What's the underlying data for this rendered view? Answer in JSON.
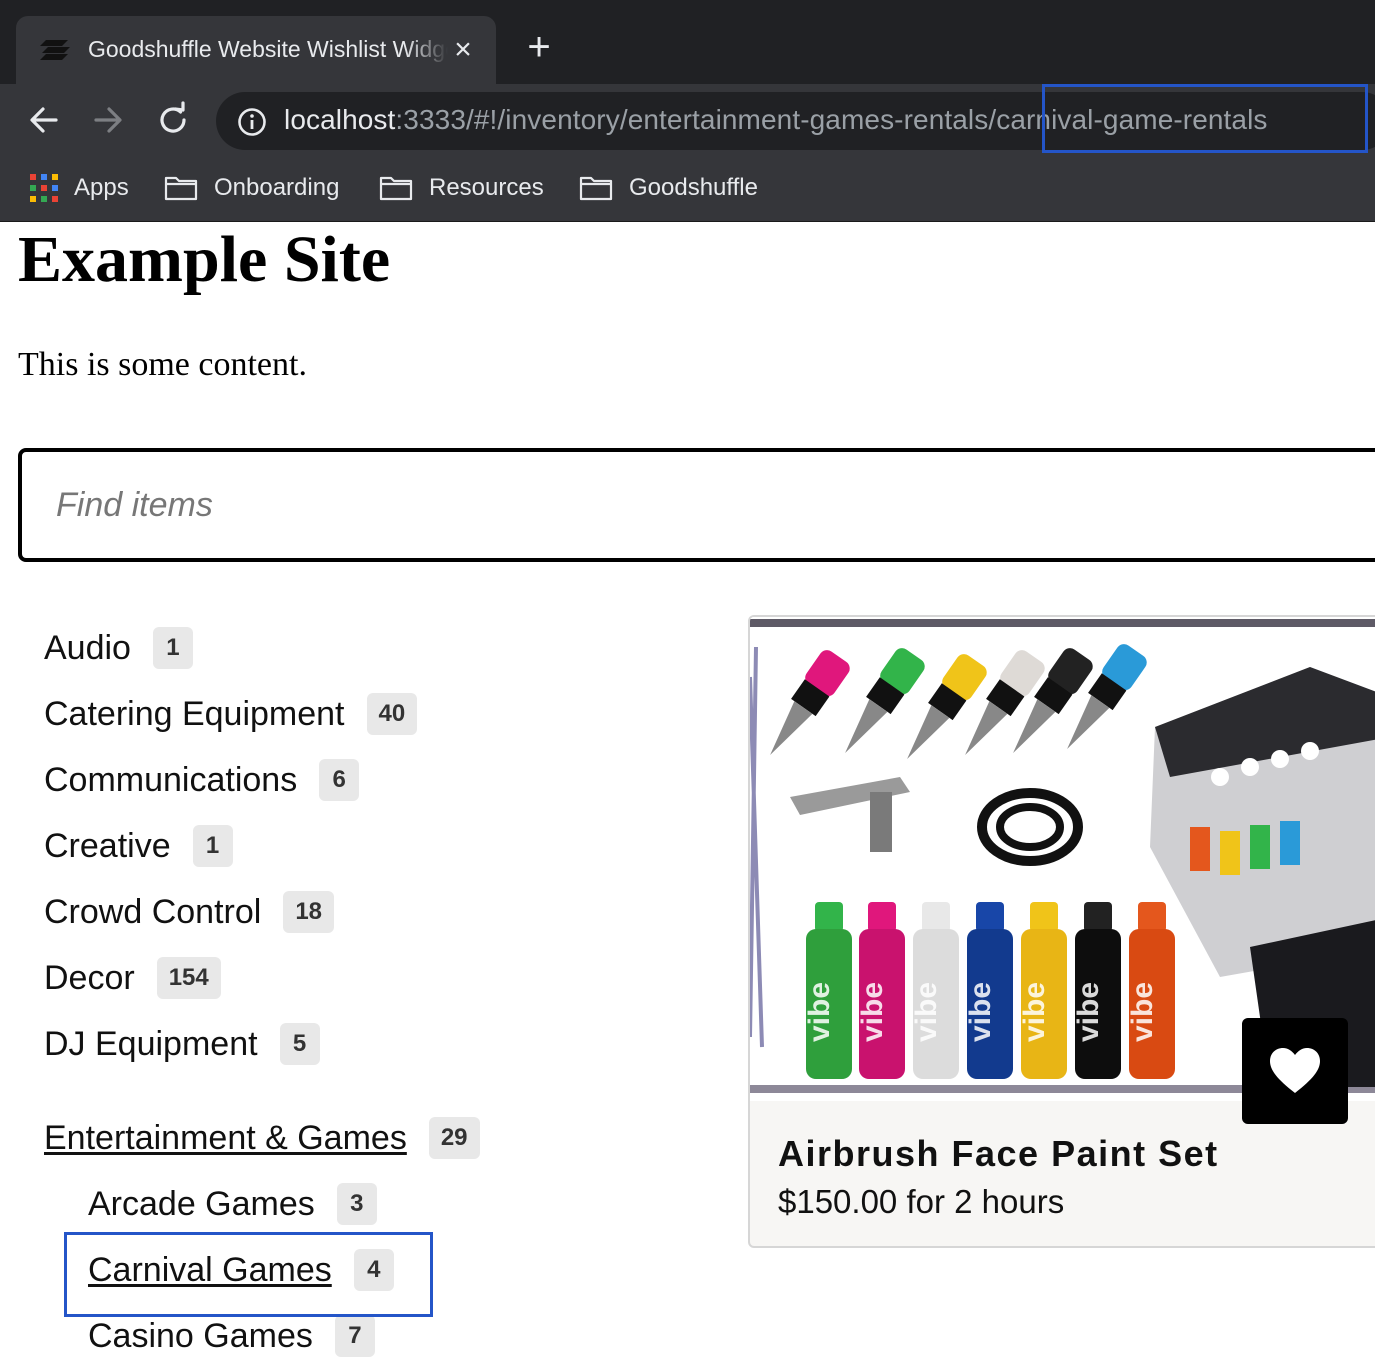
{
  "browser": {
    "tab_title": "Goodshuffle Website Wishlist Widget",
    "new_tab_symbol": "+",
    "close_symbol": "×",
    "url_host": "localhost",
    "url_path": ":3333/#!/inventory/entertainment-games-rentals/carnival-game-rentals",
    "bookmarks": [
      {
        "label": "Apps",
        "icon": "apps-grid-icon"
      },
      {
        "label": "Onboarding",
        "icon": "folder-icon"
      },
      {
        "label": "Resources",
        "icon": "folder-icon"
      },
      {
        "label": "Goodshuffle",
        "icon": "folder-icon"
      }
    ]
  },
  "page": {
    "heading": "Example Site",
    "text": "This is some content."
  },
  "search": {
    "placeholder": "Find items",
    "value": ""
  },
  "categories": [
    {
      "label": "Audio",
      "count": "1"
    },
    {
      "label": "Catering Equipment",
      "count": "40"
    },
    {
      "label": "Communications",
      "count": "6"
    },
    {
      "label": "Creative",
      "count": "1"
    },
    {
      "label": "Crowd Control",
      "count": "18"
    },
    {
      "label": "Decor",
      "count": "154"
    },
    {
      "label": "DJ Equipment",
      "count": "5"
    },
    {
      "label": "Entertainment & Games",
      "count": "29",
      "active": true
    },
    {
      "label": "Arcade Games",
      "count": "3",
      "sub": true
    },
    {
      "label": "Carnival Games",
      "count": "4",
      "sub": true,
      "selected": true
    },
    {
      "label": "Casino Games",
      "count": "7",
      "sub": true
    }
  ],
  "product": {
    "name": "Airbrush Face Paint Set",
    "price": "$150.00 for 2 hours",
    "bottle_label": "vibe",
    "image_icon": "airbrush-face-paint-photo",
    "wishlist_icon": "heart-icon"
  },
  "colors": {
    "chrome_dark": "#202124",
    "chrome_mid": "#35363a",
    "highlight_box": "#2455c8",
    "badge_bg": "#e8e8e8"
  }
}
